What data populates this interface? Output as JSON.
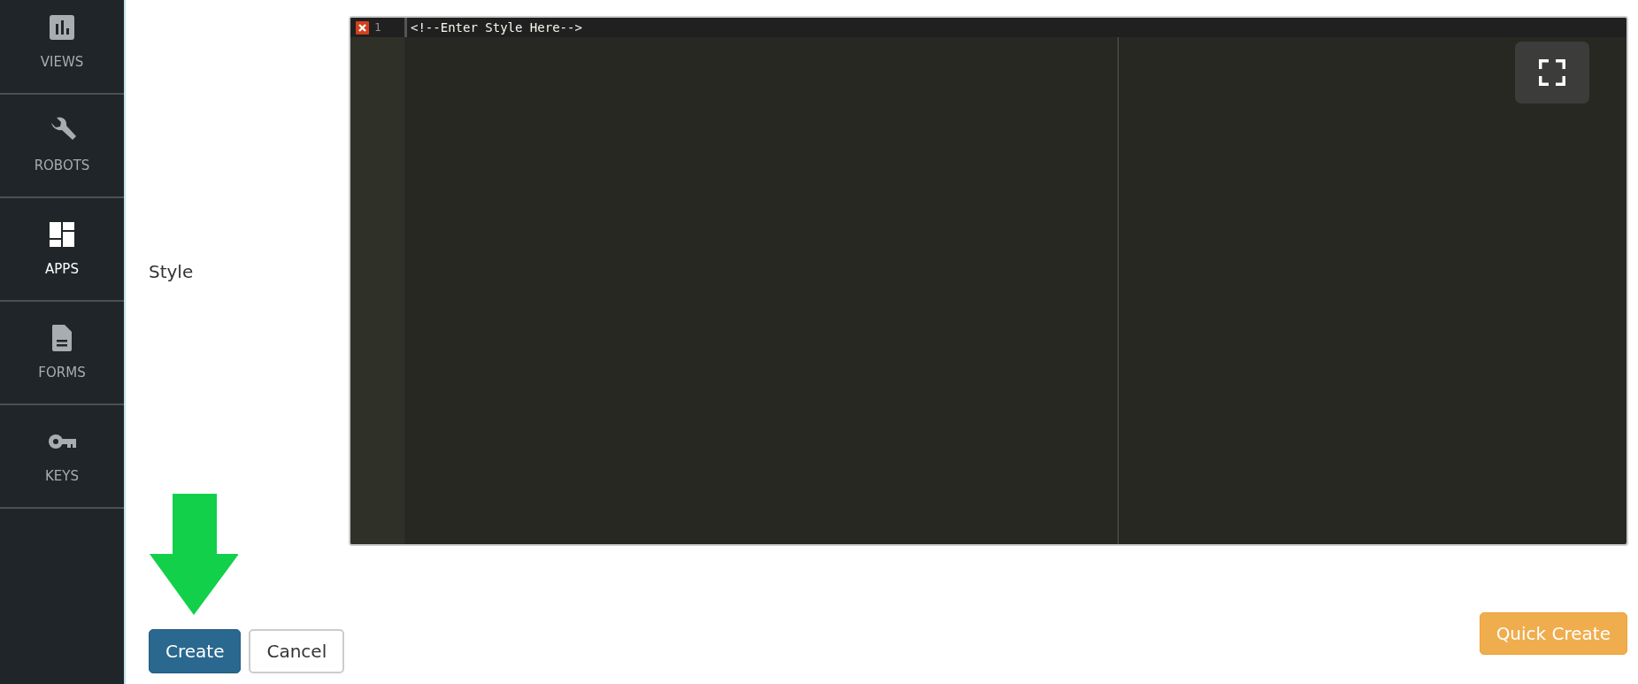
{
  "sidebar": {
    "items": [
      {
        "label": "VIEWS",
        "kind": "chart",
        "selected": false
      },
      {
        "label": "ROBOTS",
        "kind": "wrench",
        "selected": false
      },
      {
        "label": "APPS",
        "kind": "dashboard",
        "selected": true
      },
      {
        "label": "FORMS",
        "kind": "document",
        "selected": false
      },
      {
        "label": "KEYS",
        "kind": "key",
        "selected": false
      }
    ]
  },
  "form": {
    "field_label": "Style",
    "editor": {
      "lines": [
        {
          "number": "1",
          "text": "<!--Enter Style Here-->",
          "error": true,
          "active": true
        }
      ]
    }
  },
  "buttons": [
    {
      "label": "Create",
      "kind": "primary"
    },
    {
      "label": "Cancel",
      "kind": "secondary"
    },
    {
      "label": "Quick Create",
      "kind": "warning"
    }
  ]
}
